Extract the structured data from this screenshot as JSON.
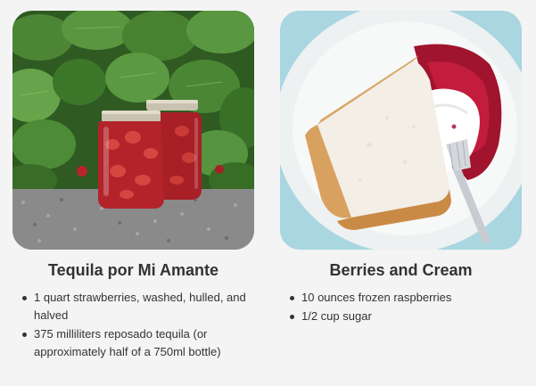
{
  "recipes": [
    {
      "title": "Tequila por Mi Amante",
      "image_icon": "strawberry-jars-photo",
      "ingredients": [
        "1 quart strawberries, washed, hulled, and halved",
        "375 milliliters reposado tequila (or approximately half of a 750ml bottle)"
      ]
    },
    {
      "title": "Berries and Cream",
      "image_icon": "angel-food-cake-photo",
      "ingredients": [
        "10 ounces frozen raspberries",
        "1/2 cup sugar"
      ]
    }
  ],
  "colors": {
    "background": "#f4f4f4",
    "text": "#333333",
    "strawberry_red": "#c0272d",
    "leaf_green": "#3e7d2e"
  }
}
